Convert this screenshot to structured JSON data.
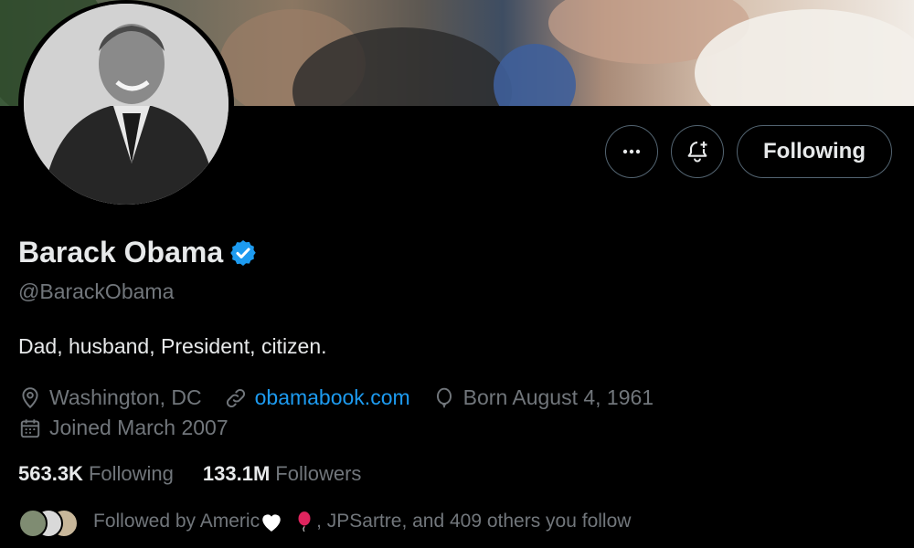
{
  "profile": {
    "name": "Barack Obama",
    "handle": "@BarackObama",
    "bio": "Dad, husband, President, citizen.",
    "location": "Washington, DC",
    "website": "obamabook.com",
    "birthday": "Born August 4, 1961",
    "joined": "Joined March 2007"
  },
  "actions": {
    "more_icon": "more-horizontal-icon",
    "notify_icon": "bell-plus-icon",
    "follow_label": "Following"
  },
  "stats": {
    "following_count": "563.3K",
    "following_label": "Following",
    "followers_count": "133.1M",
    "followers_label": "Followers"
  },
  "followed_by": {
    "text_start": "Followed by Americ",
    "text_end": ", JPSartre, and 409 others you follow"
  },
  "colors": {
    "background": "#000000",
    "text": "#e7e9ea",
    "muted": "#71767b",
    "link": "#1d9bf0",
    "border": "#536471",
    "verified": "#1d9bf0"
  }
}
